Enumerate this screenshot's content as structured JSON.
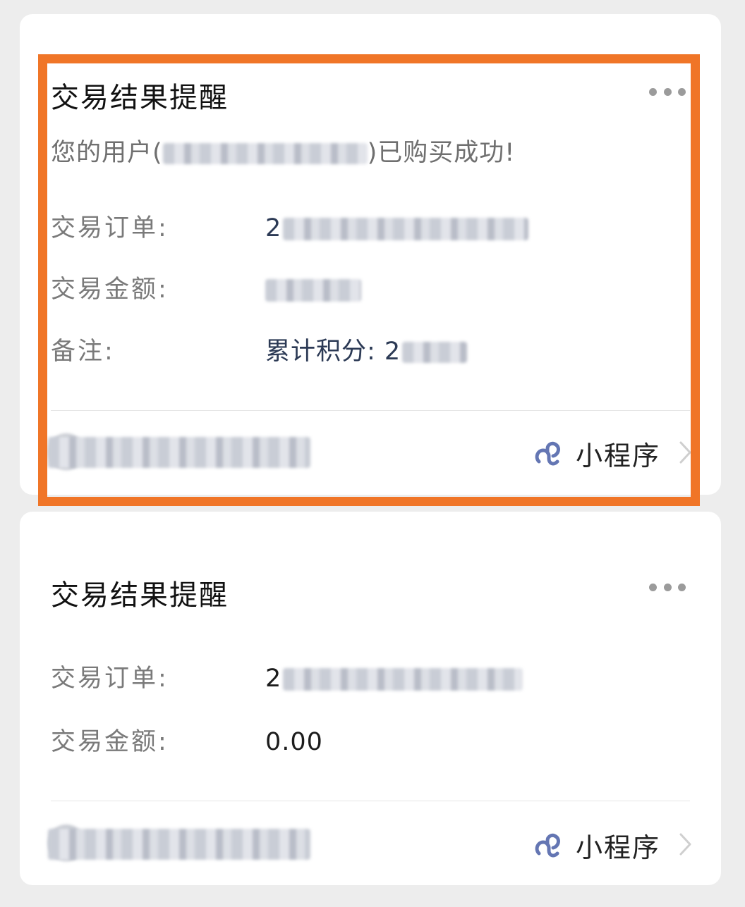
{
  "cards": [
    {
      "title": "交易结果提醒",
      "message_prefix": "您的用户(",
      "message_suffix": ")已购买成功!",
      "rows": [
        {
          "label": "交易订单:",
          "value": "2"
        },
        {
          "label": "交易金额:",
          "value": ""
        },
        {
          "label": "备注:",
          "value": "累计积分: 2"
        }
      ],
      "footer_link": "小程序"
    },
    {
      "title": "交易结果提醒",
      "rows": [
        {
          "label": "交易订单:",
          "value": "2"
        },
        {
          "label": "交易金额:",
          "value": "0.00"
        }
      ],
      "footer_link": "小程序"
    }
  ],
  "icons": {
    "more": "more-dots-icon",
    "mini_program": "mini-program-link-icon",
    "chevron": "chevron-right-icon"
  },
  "colors": {
    "highlight_border": "#f07527",
    "mini_program_icon": "#6476b3",
    "card_background": "#ffffff",
    "page_background": "#ededed"
  }
}
